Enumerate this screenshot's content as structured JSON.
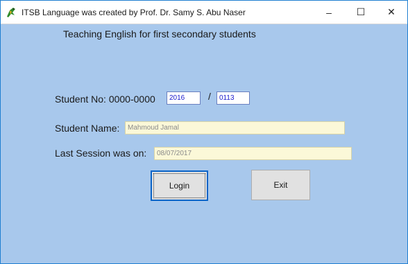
{
  "window": {
    "title": "ITSB Language was created by Prof. Dr. Samy S. Abu Naser",
    "controls": {
      "minimize": "–",
      "maximize": "☐",
      "close": "✕"
    }
  },
  "form": {
    "heading": "Teaching English for first secondary students",
    "student_no": {
      "label": "Student No: 0000-0000",
      "part1": "2016",
      "separator": "/",
      "part2": "0113"
    },
    "student_name": {
      "label": "Student Name:",
      "value": "Mahmoud Jamal"
    },
    "last_session": {
      "label": "Last Session was on:",
      "value": "08/07/2017"
    }
  },
  "buttons": {
    "login": "Login",
    "exit": "Exit"
  },
  "colors": {
    "form_bg": "#a8c8ec",
    "readonly_bg": "#fbf8d8",
    "input_text_blue": "#1a1acc",
    "focus_border": "#0a64c8"
  },
  "icons": {
    "app": "green-parrot-icon"
  }
}
